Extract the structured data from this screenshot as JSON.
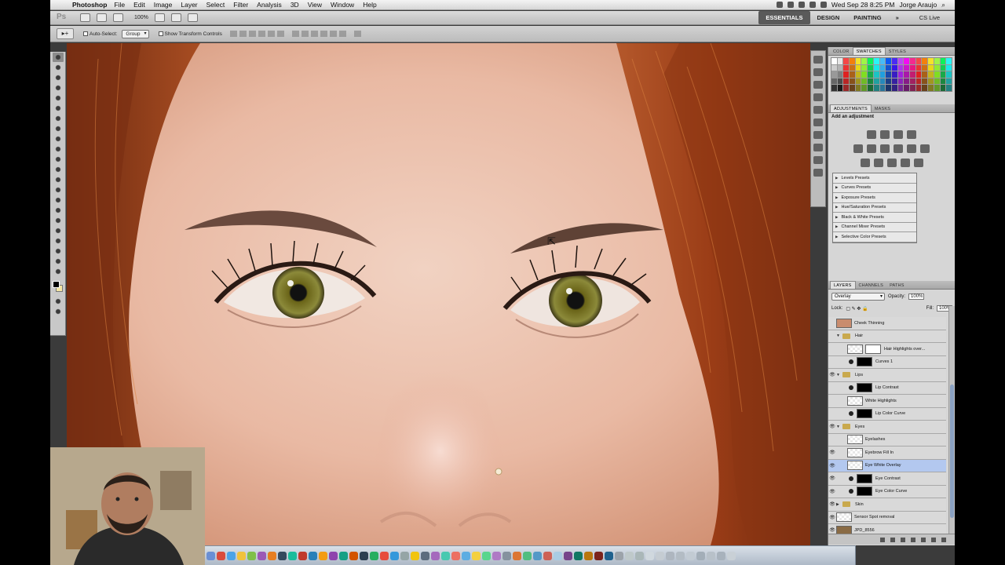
{
  "menubar": {
    "app_name": "Photoshop",
    "items": [
      "File",
      "Edit",
      "Image",
      "Layer",
      "Select",
      "Filter",
      "Analysis",
      "3D",
      "View",
      "Window",
      "Help"
    ],
    "datetime": "Wed Sep 28  8:25 PM",
    "user": "Jorge Araujo"
  },
  "appbar": {
    "zoom": "100%",
    "workspaces": [
      "ESSENTIALS",
      "DESIGN",
      "PAINTING"
    ],
    "active_workspace": "ESSENTIALS",
    "cs_live": "CS Live"
  },
  "options": {
    "auto_select_label": "Auto-Select:",
    "auto_select_value": "Group",
    "transform_label": "Show Transform Controls"
  },
  "swatches_panel": {
    "tabs": [
      "COLOR",
      "SWATCHES",
      "STYLES"
    ],
    "active_tab": "SWATCHES"
  },
  "adjustments_panel": {
    "tabs": [
      "ADJUSTMENTS",
      "MASKS"
    ],
    "active_tab": "ADJUSTMENTS",
    "title": "Add an adjustment",
    "presets": [
      "Levels Presets",
      "Curves Presets",
      "Exposure Presets",
      "Hue/Saturation Presets",
      "Black & White Presets",
      "Channel Mixer Presets",
      "Selective Color Presets"
    ]
  },
  "layers_panel": {
    "tabs": [
      "LAYERS",
      "CHANNELS",
      "PATHS"
    ],
    "active_tab": "LAYERS",
    "blend_mode": "Overlay",
    "opacity_label": "Opacity:",
    "opacity_value": "100%",
    "lock_label": "Lock:",
    "fill_label": "Fill:",
    "fill_value": "100%",
    "layers": [
      {
        "name": "Cheek Thinning"
      },
      {
        "name": "Hair"
      },
      {
        "name": "Hair Highlights over..."
      },
      {
        "name": "Curves 1"
      },
      {
        "name": "Lips"
      },
      {
        "name": "Lip Contrast"
      },
      {
        "name": "White Highlights"
      },
      {
        "name": "Lip Color Curve"
      },
      {
        "name": "Eyes"
      },
      {
        "name": "Eyelashes"
      },
      {
        "name": "Eyebrow Fill In"
      },
      {
        "name": "Eye White Overlay"
      },
      {
        "name": "Eye Contrast"
      },
      {
        "name": "Eye Color Curve"
      },
      {
        "name": "Skin"
      },
      {
        "name": "Sensor Spot removal"
      },
      {
        "name": "JPD_8556"
      }
    ]
  }
}
